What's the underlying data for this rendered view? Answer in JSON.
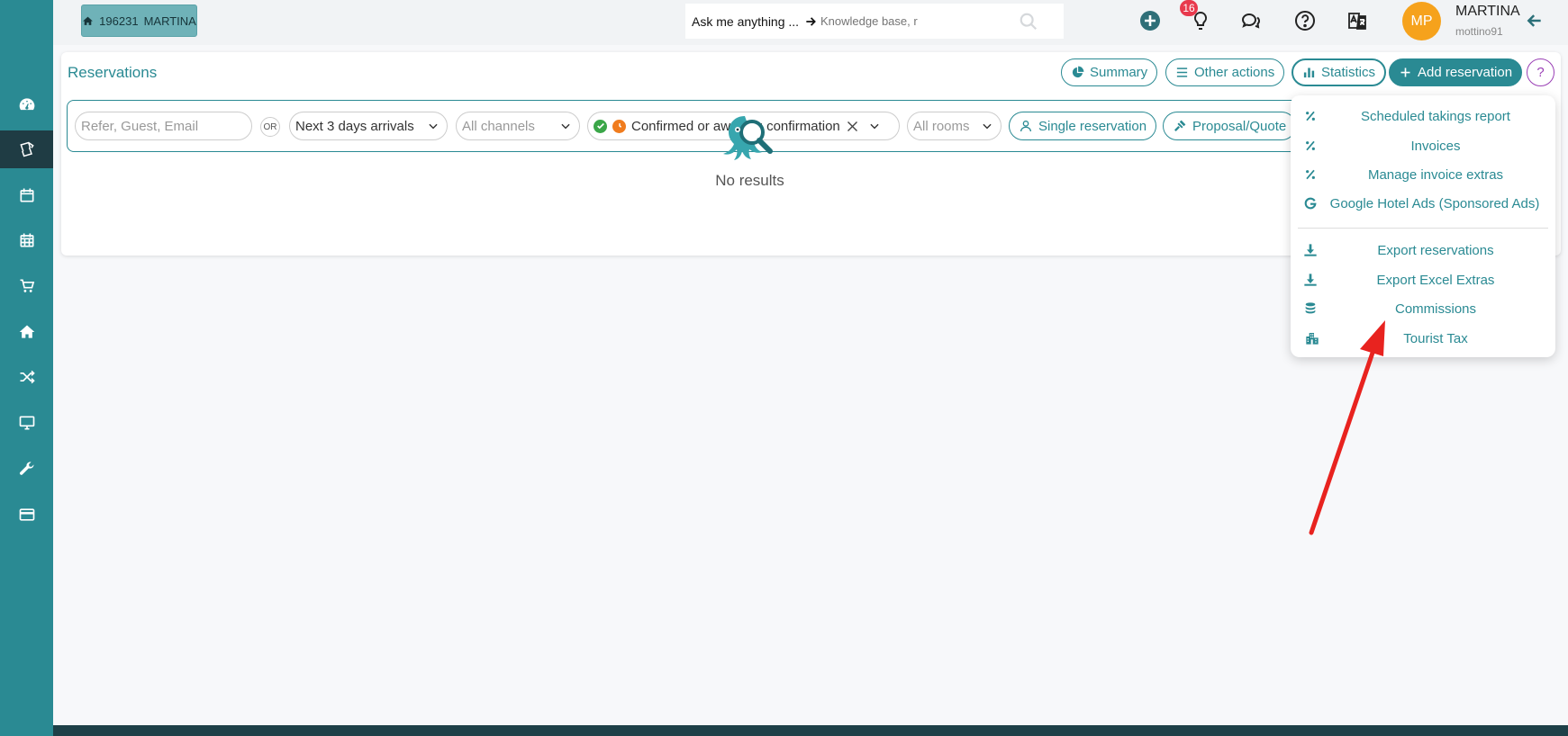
{
  "account": {
    "id": "196231",
    "name": "MARTINA"
  },
  "ask": {
    "label": "Ask me anything ...",
    "placeholder": "Knowledge base, r"
  },
  "notifications": {
    "count": "16"
  },
  "user": {
    "initials": "MP",
    "name": "MARTINA",
    "handle": "mottino91"
  },
  "page": {
    "title": "Reservations"
  },
  "header_buttons": {
    "summary": "Summary",
    "other_actions": "Other actions",
    "statistics": "Statistics",
    "add_reservation": "Add reservation",
    "help": "?"
  },
  "filters": {
    "search_placeholder": "Refer, Guest, Email",
    "or_label": "OR",
    "period": "Next 3 days arrivals",
    "channels": "All channels",
    "status": "Confirmed or awaiting confirmation",
    "rooms": "All rooms",
    "single_reservation": "Single reservation",
    "proposal_quote": "Proposal/Quote"
  },
  "empty_state": {
    "text": "No results"
  },
  "statistics_menu": {
    "items": [
      {
        "label": "Scheduled takings report",
        "icon": "percent-icon"
      },
      {
        "label": "Invoices",
        "icon": "percent-icon"
      },
      {
        "label": "Manage invoice extras",
        "icon": "percent-icon"
      },
      {
        "label": "Google Hotel Ads (Sponsored Ads)",
        "icon": "google-icon"
      },
      {
        "label": "Export reservations",
        "icon": "download-icon"
      },
      {
        "label": "Export Excel Extras",
        "icon": "download-icon"
      },
      {
        "label": "Commissions",
        "icon": "coins-icon"
      },
      {
        "label": "Tourist Tax",
        "icon": "city-icon"
      }
    ]
  },
  "colors": {
    "brand": "#2a8a93",
    "sidebar_active": "#1f3c44",
    "avatar": "#f6a21c",
    "badge": "#e8394d",
    "annotation_arrow": "#e8231f"
  }
}
